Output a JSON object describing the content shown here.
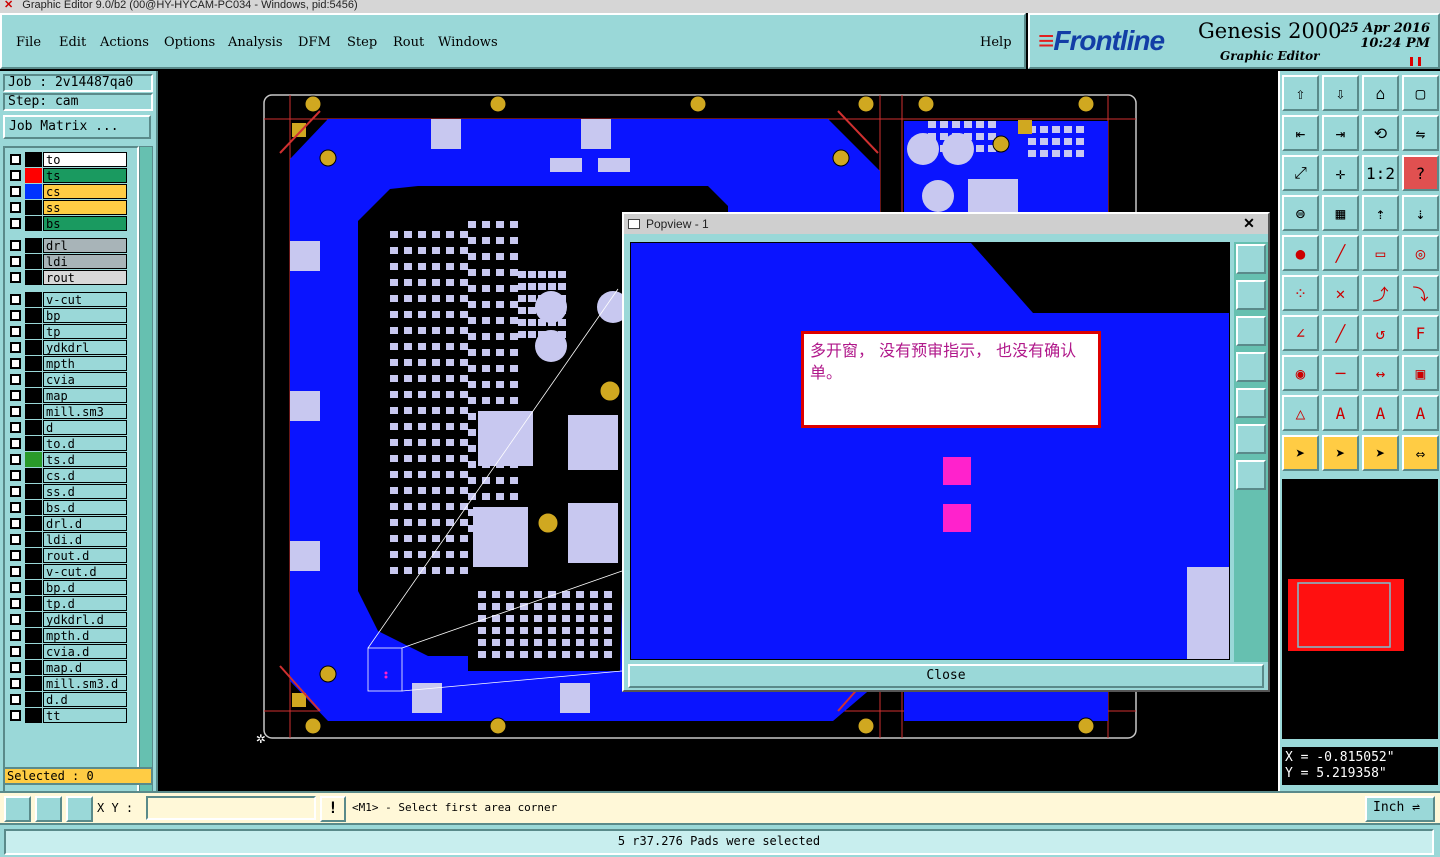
{
  "window": {
    "title": "Graphic Editor 9.0/b2 (00@HY-HYCAM-PC034 - Windows, pid:5456)"
  },
  "menu": {
    "items": [
      "File",
      "Edit",
      "Actions",
      "Options",
      "Analysis",
      "DFM",
      "Step",
      "Rout",
      "Windows"
    ],
    "help": "Help"
  },
  "brand": {
    "logo": "Frontline",
    "product": "Genesis 2000",
    "subtitle": "Graphic Editor",
    "date": "25 Apr 2016",
    "time": "10:24 PM"
  },
  "job": {
    "job_line": "Job : 2v14487qa0",
    "step_line": "Step: cam",
    "matrix_button": "Job Matrix ..."
  },
  "layers": [
    {
      "name": "to",
      "color": "#000000",
      "bg": "#ffffff"
    },
    {
      "name": "ts",
      "color": "#ff0000",
      "bg": "#1a9a60"
    },
    {
      "name": "cs",
      "color": "#0033ff",
      "bg": "#ffcc44"
    },
    {
      "name": "ss",
      "color": "#000000",
      "bg": "#ffcc44"
    },
    {
      "name": "bs",
      "color": "#000000",
      "bg": "#1a9a60"
    },
    {
      "name": "drl",
      "color": "#000000",
      "bg": "#a8b4b8"
    },
    {
      "name": "ldi",
      "color": "#000000",
      "bg": "#a8b4b8"
    },
    {
      "name": "rout",
      "color": "#000000",
      "bg": "#d8d8d8"
    },
    {
      "name": "v-cut",
      "color": "#000000",
      "bg": "#9ad8d8"
    },
    {
      "name": "bp",
      "color": "#000000",
      "bg": "#9ad8d8"
    },
    {
      "name": "tp",
      "color": "#000000",
      "bg": "#9ad8d8"
    },
    {
      "name": "ydkdrl",
      "color": "#000000",
      "bg": "#9ad8d8"
    },
    {
      "name": "mpth",
      "color": "#000000",
      "bg": "#9ad8d8"
    },
    {
      "name": "cvia",
      "color": "#000000",
      "bg": "#9ad8d8"
    },
    {
      "name": "map",
      "color": "#000000",
      "bg": "#9ad8d8"
    },
    {
      "name": "mill.sm3",
      "color": "#000000",
      "bg": "#9ad8d8"
    },
    {
      "name": "d",
      "color": "#000000",
      "bg": "#9ad8d8"
    },
    {
      "name": "to.d",
      "color": "#000000",
      "bg": "#9ad8d8"
    },
    {
      "name": "ts.d",
      "color": "#2a9a2a",
      "bg": "#9ad8d8"
    },
    {
      "name": "cs.d",
      "color": "#000000",
      "bg": "#9ad8d8"
    },
    {
      "name": "ss.d",
      "color": "#000000",
      "bg": "#9ad8d8"
    },
    {
      "name": "bs.d",
      "color": "#000000",
      "bg": "#9ad8d8"
    },
    {
      "name": "drl.d",
      "color": "#000000",
      "bg": "#9ad8d8"
    },
    {
      "name": "ldi.d",
      "color": "#000000",
      "bg": "#9ad8d8"
    },
    {
      "name": "rout.d",
      "color": "#000000",
      "bg": "#9ad8d8"
    },
    {
      "name": "v-cut.d",
      "color": "#000000",
      "bg": "#9ad8d8"
    },
    {
      "name": "bp.d",
      "color": "#000000",
      "bg": "#9ad8d8"
    },
    {
      "name": "tp.d",
      "color": "#000000",
      "bg": "#9ad8d8"
    },
    {
      "name": "ydkdrl.d",
      "color": "#000000",
      "bg": "#9ad8d8"
    },
    {
      "name": "mpth.d",
      "color": "#000000",
      "bg": "#9ad8d8"
    },
    {
      "name": "cvia.d",
      "color": "#000000",
      "bg": "#9ad8d8"
    },
    {
      "name": "map.d",
      "color": "#000000",
      "bg": "#9ad8d8"
    },
    {
      "name": "mill.sm3.d",
      "color": "#000000",
      "bg": "#9ad8d8"
    },
    {
      "name": "d.d",
      "color": "#000000",
      "bg": "#9ad8d8"
    },
    {
      "name": "tt",
      "color": "#000000",
      "bg": "#9ad8d8"
    }
  ],
  "selected": "Selected : 0",
  "popup": {
    "title": "Popview - 1",
    "note": "多开窗， 没有预审指示， 也没有确认单。",
    "close_label": "Close"
  },
  "coords": {
    "x": "X = -0.815052\"",
    "y": "Y = 5.219358\""
  },
  "status": {
    "xy_label": "X Y :",
    "xy_value": "",
    "prompt": "<M1> - Select first area corner",
    "units": "Inch"
  },
  "footer": {
    "message": "5 r37.276 Pads were selected"
  },
  "colors": {
    "panel": "#9ad8d8",
    "copper": "#0a14ff",
    "highlight": "#ff22cc",
    "accent": "#ffcc44"
  }
}
